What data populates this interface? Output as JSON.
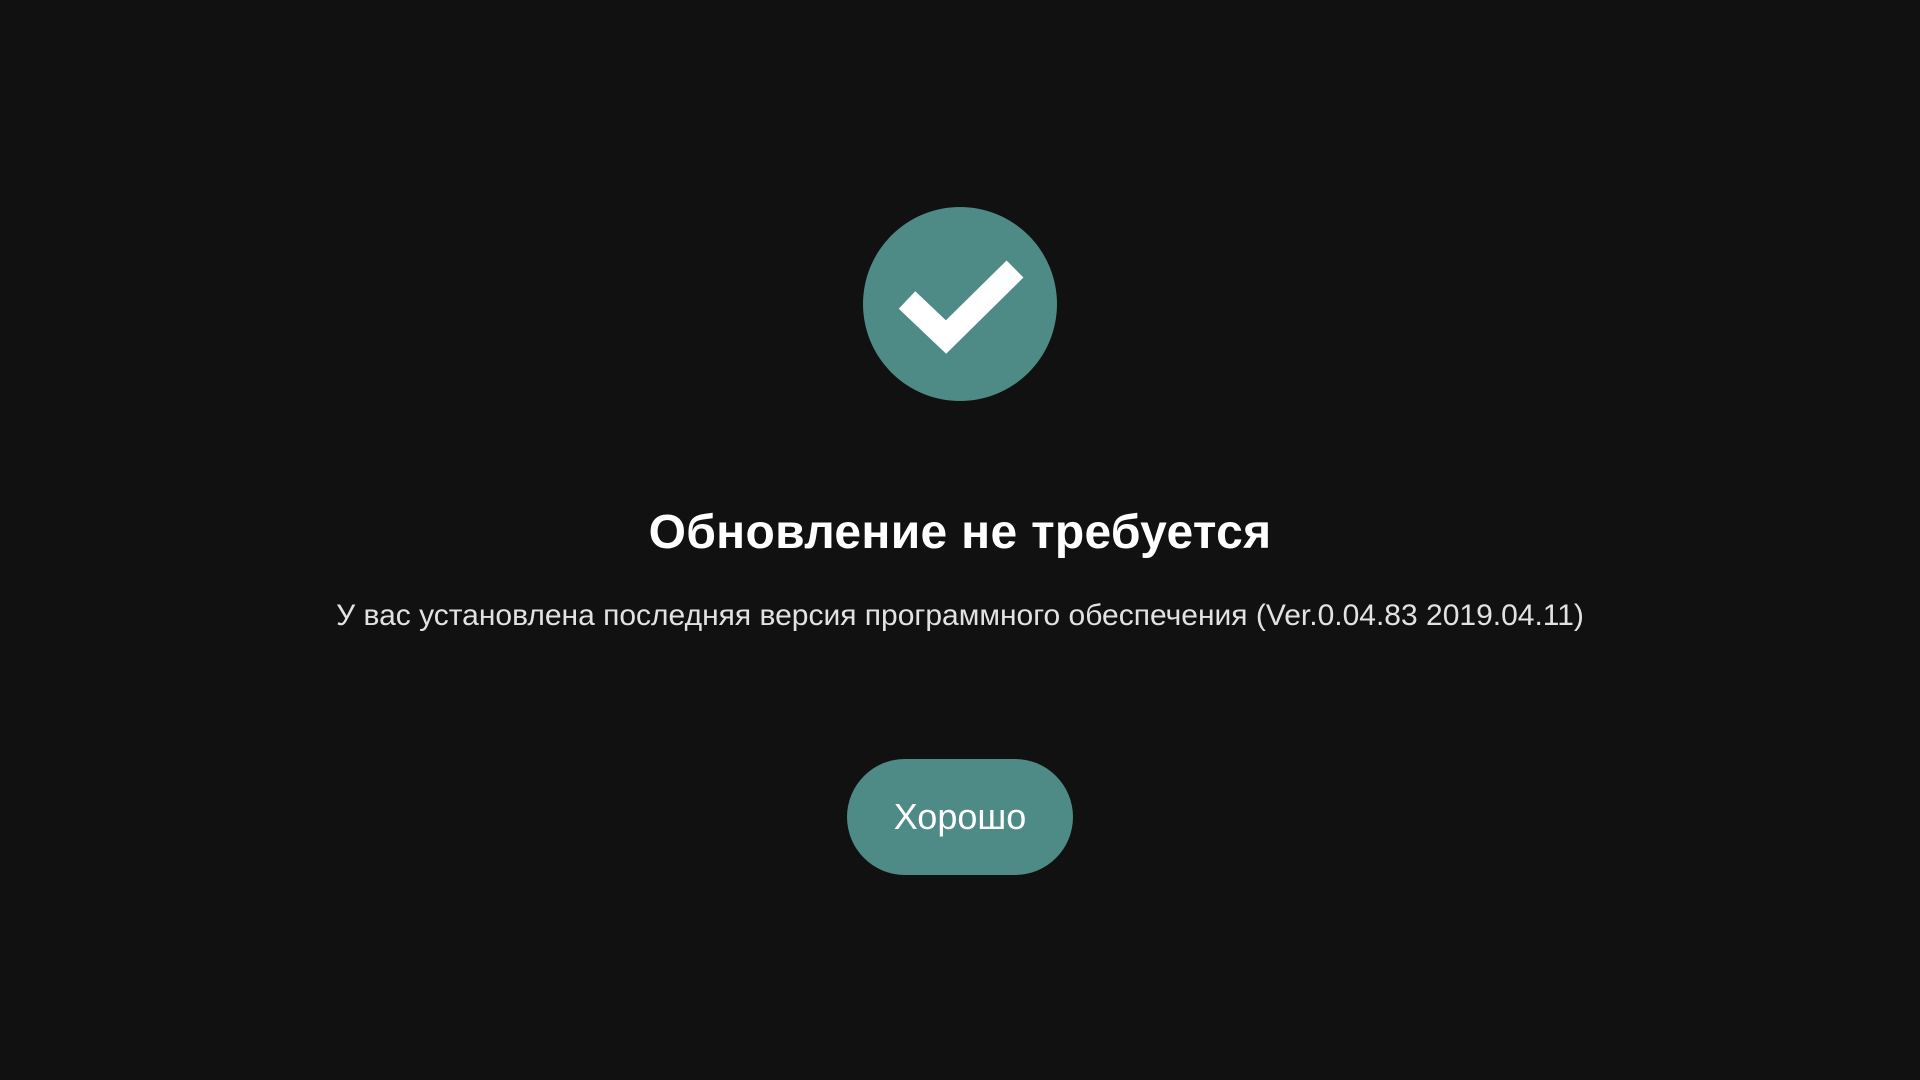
{
  "dialog": {
    "icon": "checkmark-icon",
    "accent_color": "#4e8a86",
    "title": "Обновление не требуется",
    "message": "У вас установлена последняя версия программного обеспечения (Ver.0.04.83 2019.04.11)",
    "ok_label": "Хорошо"
  }
}
